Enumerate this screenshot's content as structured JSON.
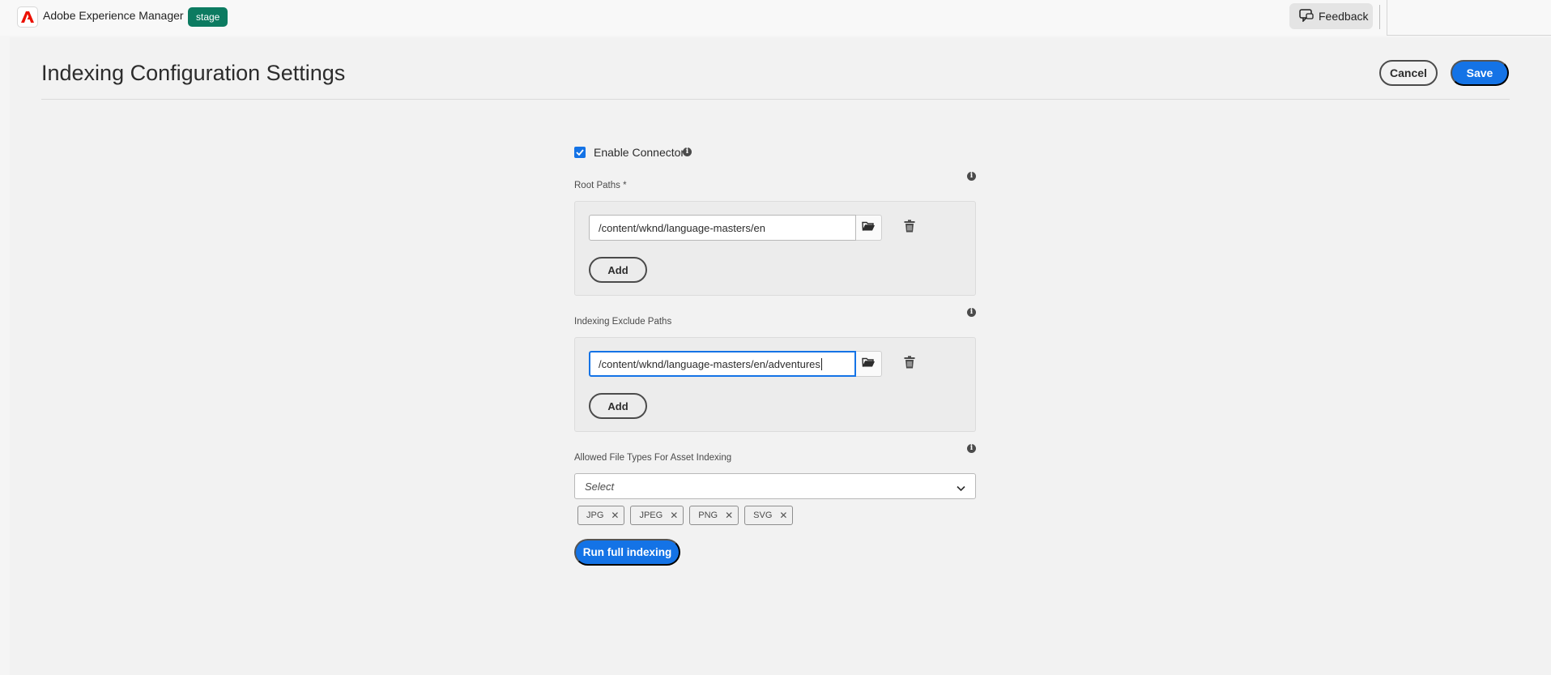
{
  "topbar": {
    "app_title": "Adobe Experience Manager",
    "environment": "stage",
    "feedback_label": "Feedback"
  },
  "header": {
    "title": "Indexing Configuration Settings",
    "cancel_label": "Cancel",
    "save_label": "Save"
  },
  "form": {
    "enable_connector": {
      "label": "Enable Connector",
      "checked": true
    },
    "root_paths": {
      "label": "Root Paths *",
      "items": [
        "/content/wknd/language-masters/en"
      ],
      "add_label": "Add"
    },
    "exclude_paths": {
      "label": "Indexing Exclude Paths",
      "items": [
        "/content/wknd/language-masters/en/adventures"
      ],
      "add_label": "Add"
    },
    "file_types": {
      "label": "Allowed File Types For Asset Indexing",
      "placeholder": "Select",
      "tags": [
        "JPG",
        "JPEG",
        "PNG",
        "SVG"
      ]
    },
    "run_label": "Run full indexing"
  },
  "colors": {
    "accent": "#1473e6",
    "env_badge": "#0c7b61",
    "adobe_red": "#eb1000"
  },
  "icons": {
    "logo": "adobe-logo-icon",
    "feedback": "feedback-icon",
    "info": "info-icon",
    "browse": "folder-icon",
    "delete": "trash-icon",
    "dropdown": "chevron-down-icon",
    "tag_remove": "close-icon"
  }
}
